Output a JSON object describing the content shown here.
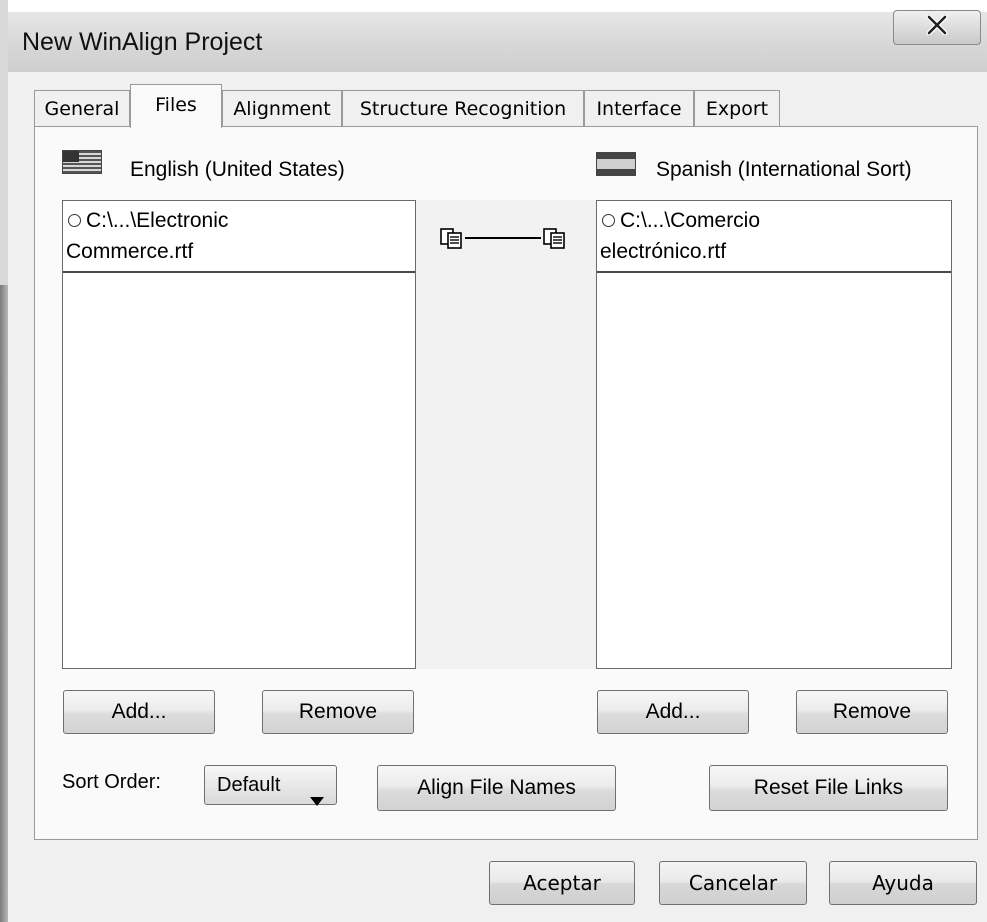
{
  "window": {
    "title": "New WinAlign Project",
    "close_glyph": "X"
  },
  "tabs": [
    {
      "label": "General",
      "active": false
    },
    {
      "label": "Files",
      "active": true
    },
    {
      "label": "Alignment",
      "active": false
    },
    {
      "label": "Structure Recognition",
      "active": false
    },
    {
      "label": "Interface",
      "active": false
    },
    {
      "label": "Export",
      "active": false
    }
  ],
  "files_tab": {
    "source": {
      "language": "English (United States)",
      "flag_icon": "us-flag-icon",
      "files": [
        {
          "line1": "C:\\...\\Electronic",
          "line2": "Commerce.rtf"
        }
      ],
      "add_label": "Add...",
      "remove_label": "Remove"
    },
    "target": {
      "language": "Spanish (International Sort)",
      "flag_icon": "spain-flag-icon",
      "files": [
        {
          "line1": "C:\\...\\Comercio",
          "line2": "electrónico.rtf"
        }
      ],
      "add_label": "Add...",
      "remove_label": "Remove"
    },
    "sort_order_label": "Sort Order:",
    "sort_order_value": "Default",
    "align_file_names_label": "Align File Names",
    "reset_file_links_label": "Reset File Links"
  },
  "footer": {
    "ok_label": "Aceptar",
    "cancel_label": "Cancelar",
    "help_label": "Ayuda"
  }
}
